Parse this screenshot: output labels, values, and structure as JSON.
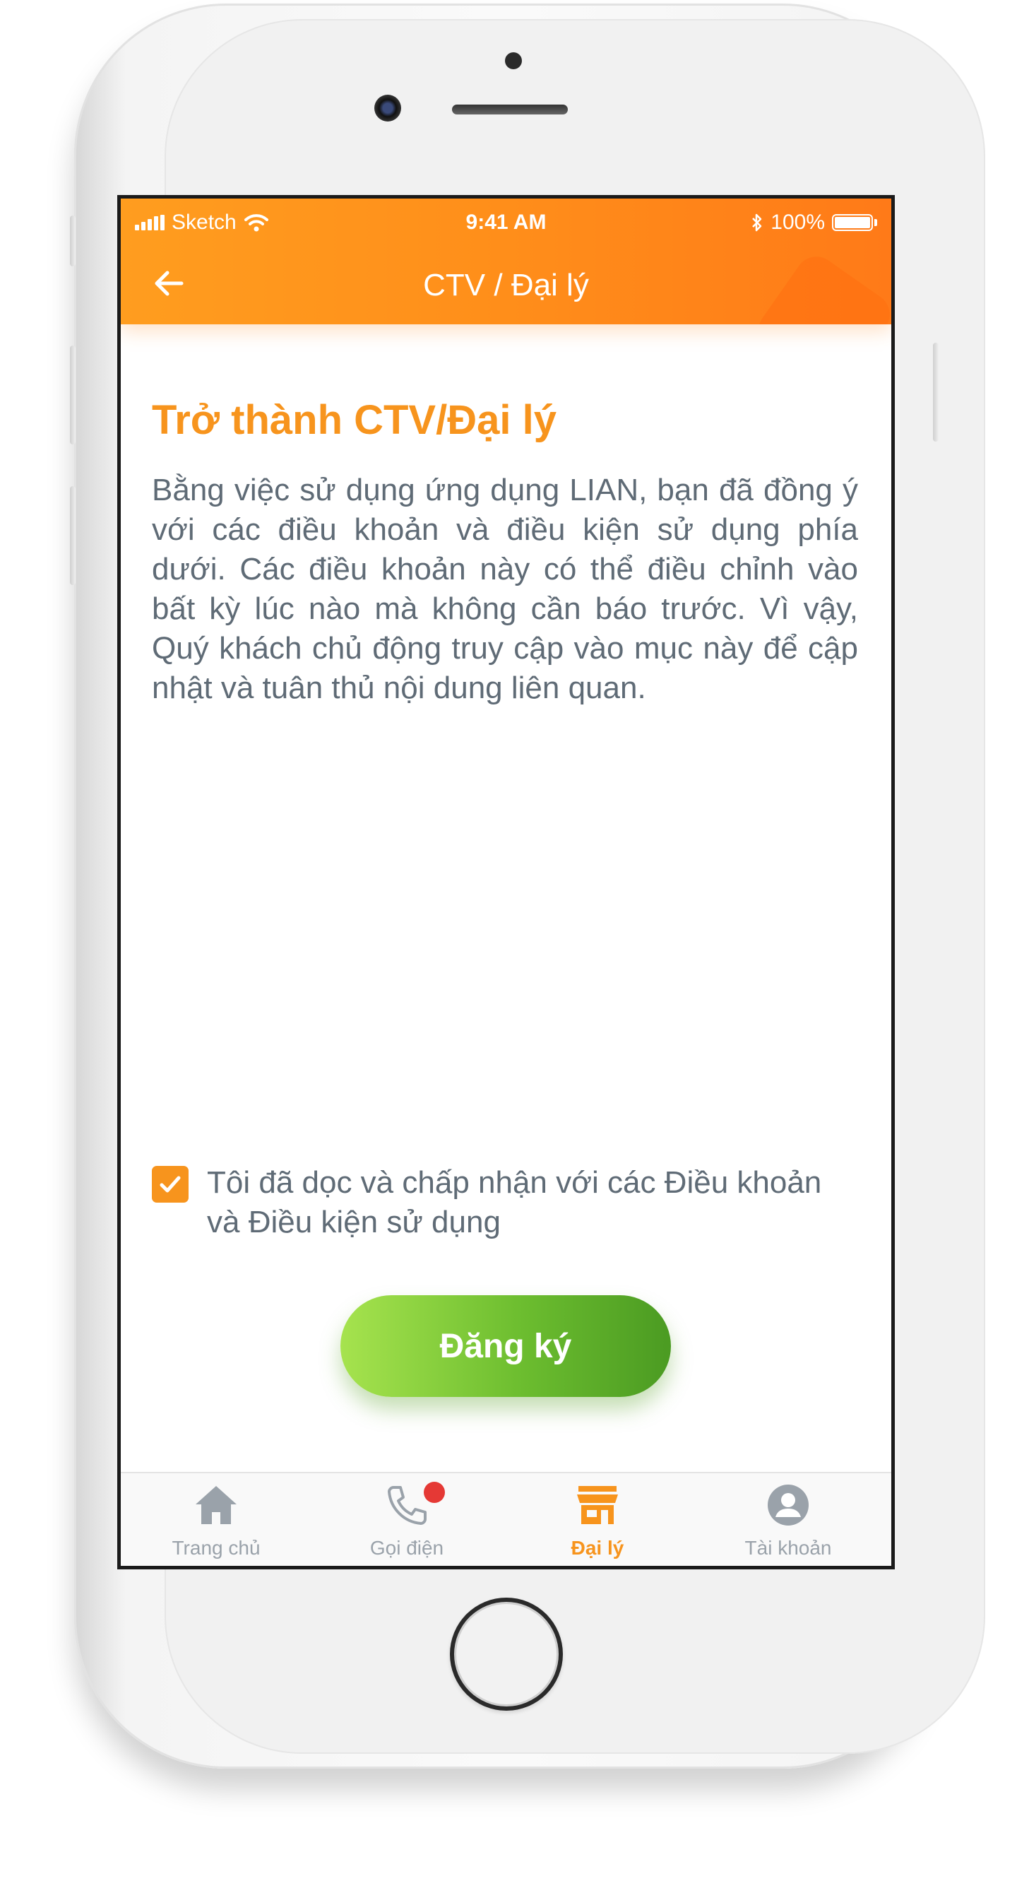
{
  "status_bar": {
    "carrier": "Sketch",
    "time": "9:41 AM",
    "battery": "100%"
  },
  "header": {
    "title": "CTV / Đại lý",
    "back_icon": "arrow-left-icon"
  },
  "main": {
    "heading": "Trở thành CTV/Đại lý",
    "description": "Bằng việc sử dụng ứng dụng LIAN, bạn đã đồng ý với các điều khoản và điều kiện sử dụng phía dưới. Các điều khoản này có thể điều chỉnh vào bất kỳ lúc nào mà không cần báo trước. Vì vậy, Quý khách chủ động truy cập vào mục này để cập nhật và tuân thủ nội dung liên quan.",
    "agree_checked": true,
    "agree_label": "Tôi đã dọc và chấp nhận với các Điều khoản và Điều kiện sử dụng",
    "register_label": "Đăng ký"
  },
  "tabbar": {
    "items": [
      {
        "label": "Trang chủ",
        "icon": "home-icon"
      },
      {
        "label": "Gọi điện",
        "icon": "phone-icon"
      },
      {
        "label": "Đại lý",
        "icon": "store-icon"
      },
      {
        "label": "Tài khoản",
        "icon": "account-icon"
      }
    ],
    "active_index": 2
  },
  "colors": {
    "accent": "#f7941d",
    "header_start": "#ff9d1f",
    "header_end": "#ff7a18",
    "button_start": "#a6e34e",
    "button_end": "#4b9b22",
    "text": "#5f6b76",
    "inactive": "#9aa2aa",
    "badge": "#e53935"
  }
}
